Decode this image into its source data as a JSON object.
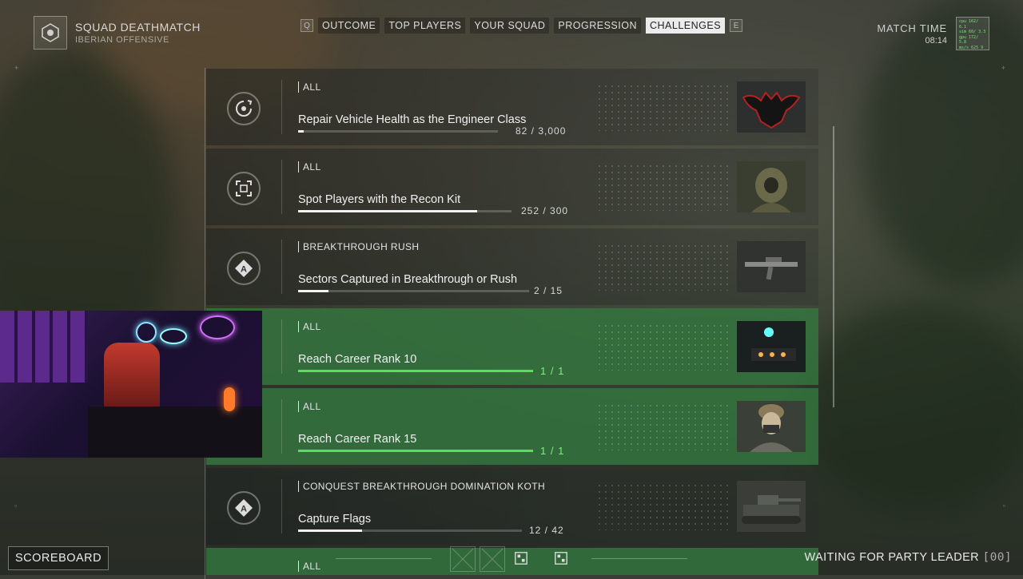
{
  "header": {
    "mode_title": "SQUAD DEATHMATCH",
    "mode_subtitle": "IBERIAN OFFENSIVE",
    "tab_left_key": "Q",
    "tab_right_key": "E",
    "tabs": [
      {
        "label": "OUTCOME"
      },
      {
        "label": "TOP PLAYERS"
      },
      {
        "label": "YOUR SQUAD"
      },
      {
        "label": "PROGRESSION"
      },
      {
        "label": "CHALLENGES",
        "active": true
      }
    ],
    "match_time_label": "MATCH TIME",
    "match_time_value": "08:14",
    "perf_overlay": [
      "cpu 162/ 6.1",
      "sim 60/ 3.3",
      "gpu 172/ 5.8",
      "ms/s 625 9"
    ]
  },
  "challenges": [
    {
      "category": "ALL",
      "name": "Repair Vehicle Health as the Engineer Class",
      "progress_text": "82 / 3,000",
      "progress": 0.027,
      "completed": false,
      "icon": "repair-icon",
      "thumb": "bat-emblem"
    },
    {
      "category": "ALL",
      "name": "Spot Players with the Recon Kit",
      "progress_text": "252 / 300",
      "progress": 0.84,
      "completed": false,
      "icon": "spot-icon",
      "thumb": "ghillie-soldier"
    },
    {
      "category": "BREAKTHROUGH RUSH",
      "name": "Sectors Captured in Breakthrough or Rush",
      "progress_text": "2 / 15",
      "progress": 0.133,
      "completed": false,
      "icon": "objective-a-icon",
      "thumb": "rifle"
    },
    {
      "category": "ALL",
      "name": "Reach Career Rank 10",
      "progress_text": "1 / 1",
      "progress": 1,
      "completed": true,
      "icon": "rank-icon",
      "thumb": "vehicle-lights"
    },
    {
      "category": "ALL",
      "name": "Reach Career Rank 15",
      "progress_text": "1 / 1",
      "progress": 1,
      "completed": true,
      "icon": "rank-icon",
      "thumb": "masked-soldier"
    },
    {
      "category": "CONQUEST BREAKTHROUGH DOMINATION KOTH",
      "name": "Capture Flags",
      "progress_text": "12 / 42",
      "progress": 0.286,
      "completed": false,
      "icon": "objective-a-icon",
      "thumb": "tank"
    },
    {
      "category": "ALL",
      "name": "",
      "progress_text": "",
      "progress": 0,
      "completed": false,
      "icon": "",
      "thumb": ""
    }
  ],
  "footer": {
    "scoreboard_label": "SCOREBOARD",
    "waiting_label": "WAITING FOR PARTY LEADER",
    "waiting_code": "[00]"
  },
  "colors": {
    "complete_green": "#57e05a",
    "complete_bg": "#347640",
    "active_tab_bg": "#ececec"
  }
}
